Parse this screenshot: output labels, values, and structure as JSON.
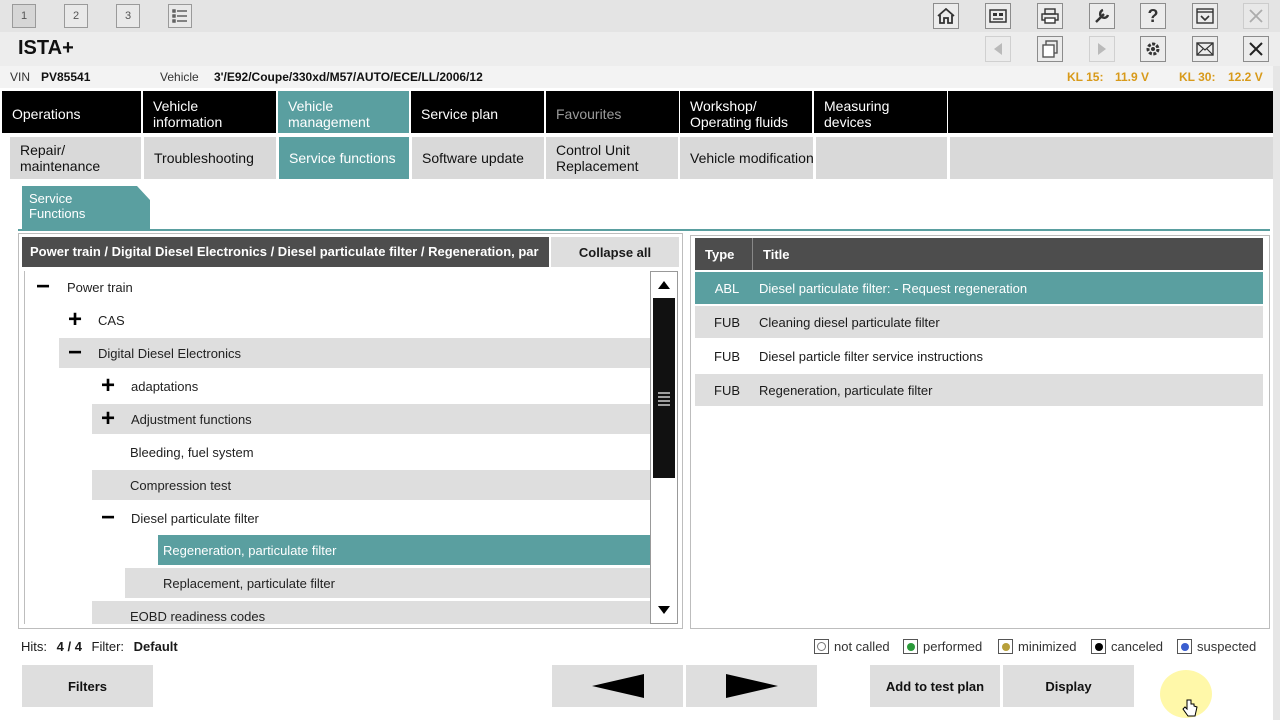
{
  "topbar": {
    "windows": [
      "1",
      "2",
      "3"
    ]
  },
  "title": "ISTA+",
  "info": {
    "vin_label": "VIN",
    "vin": "PV85541",
    "vehicle_label": "Vehicle",
    "vehicle": "3'/E92/Coupe/330xd/M57/AUTO/ECE/LL/2006/12",
    "kl15_label": "KL 15:",
    "kl15": "11.9 V",
    "kl30_label": "KL 30:",
    "kl30": "12.2 V"
  },
  "main_tabs": [
    {
      "label": "Operations"
    },
    {
      "label": "Vehicle information"
    },
    {
      "label": "Vehicle management"
    },
    {
      "label": "Service plan"
    },
    {
      "label": "Favourites"
    },
    {
      "label": "Workshop/ Operating fluids"
    },
    {
      "label": "Measuring devices"
    }
  ],
  "sub_tabs": [
    {
      "label": "Repair/ maintenance"
    },
    {
      "label": "Troubleshooting"
    },
    {
      "label": "Service functions"
    },
    {
      "label": "Software update"
    },
    {
      "label": "Control Unit Replacement"
    },
    {
      "label": "Vehicle modification"
    }
  ],
  "section_tab": "Service Functions",
  "left": {
    "path": "Power train / Digital Diesel Electronics / Diesel particulate filter / Regeneration, par",
    "collapse_label": "Collapse all",
    "tree": [
      {
        "sign": "−",
        "label": "Power train"
      },
      {
        "sign": "+",
        "label": "CAS"
      },
      {
        "sign": "−",
        "label": "Digital Diesel Electronics"
      },
      {
        "sign": "+",
        "label": "adaptations"
      },
      {
        "sign": "+",
        "label": "Adjustment functions"
      },
      {
        "sign": "",
        "label": "Bleeding, fuel system"
      },
      {
        "sign": "",
        "label": "Compression test"
      },
      {
        "sign": "−",
        "label": "Diesel particulate filter"
      },
      {
        "sign": "",
        "label": "Regeneration, particulate filter"
      },
      {
        "sign": "",
        "label": "Replacement, particulate filter"
      },
      {
        "sign": "",
        "label": "EOBD readiness codes"
      }
    ]
  },
  "right": {
    "col_type": "Type",
    "col_title": "Title",
    "rows": [
      {
        "type": "ABL",
        "title": "Diesel particulate filter: - Request regeneration"
      },
      {
        "type": "FUB",
        "title": "Cleaning diesel particulate filter"
      },
      {
        "type": "FUB",
        "title": "Diesel particle filter service instructions"
      },
      {
        "type": "FUB",
        "title": "Regeneration, particulate filter"
      }
    ]
  },
  "status": {
    "hits_label": "Hits:",
    "hits": "4 / 4",
    "filter_label": "Filter:",
    "filter": "Default"
  },
  "legend": [
    {
      "label": "not called",
      "color": "#ffffff"
    },
    {
      "label": "performed",
      "color": "#2a9a3a"
    },
    {
      "label": "minimized",
      "color": "#b8a03a"
    },
    {
      "label": "canceled",
      "color": "#000000"
    },
    {
      "label": "suspected",
      "color": "#3b5fd0"
    }
  ],
  "buttons": {
    "filters": "Filters",
    "add_to_test_plan": "Add to test plan",
    "display": "Display"
  },
  "colors": {
    "accent": "#5a9fa0",
    "kl": "#d89a1a"
  }
}
